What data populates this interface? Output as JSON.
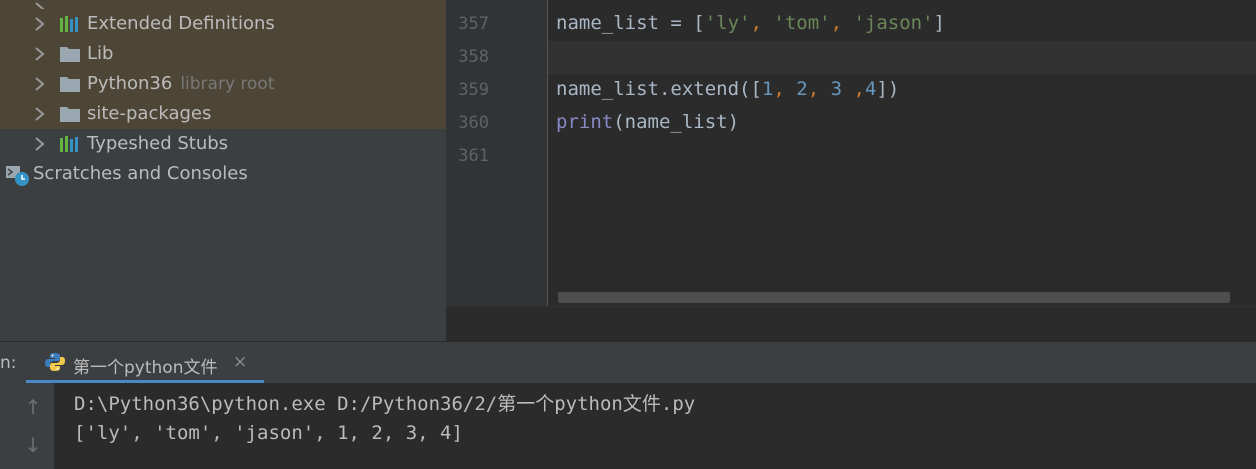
{
  "project_tree": {
    "items": [
      {
        "label": "Extended Definitions",
        "icon": "library-icon"
      },
      {
        "label": "Lib",
        "icon": "folder-icon"
      },
      {
        "label": "Python36",
        "hint": "library root",
        "icon": "folder-icon"
      },
      {
        "label": "site-packages",
        "icon": "folder-icon"
      },
      {
        "label": "Typeshed Stubs",
        "icon": "library-icon"
      }
    ],
    "scratches_label": "Scratches and Consoles"
  },
  "editor": {
    "lines": [
      {
        "number": "357"
      },
      {
        "number": "358"
      },
      {
        "number": "359"
      },
      {
        "number": "360"
      },
      {
        "number": "361"
      }
    ],
    "code": {
      "l357": {
        "a": "name_list = [",
        "s1": "'ly'",
        "c1": ", ",
        "s2": "'tom'",
        "c2": ", ",
        "s3": "'jason'",
        "b": "]"
      },
      "l359": {
        "a": "name_list.extend([",
        "n1": "1",
        "c1": ", ",
        "n2": "2",
        "c2": ", ",
        "n3": "3",
        "c3": " ,",
        "n4": "4",
        "b": "])"
      },
      "l360": {
        "fn": "print",
        "rest": "(name_list)"
      }
    }
  },
  "run_panel": {
    "label": "n:",
    "tab_label": "第一个python文件",
    "close_glyph": "×",
    "up_glyph": "↑",
    "down_glyph": "↓",
    "output": [
      "D:\\Python36\\python.exe D:/Python36/2/第一个python文件.py",
      "['ly', 'tom', 'jason', 1, 2, 3, 4]"
    ]
  },
  "colors": {
    "accent": "#4a88c7",
    "string": "#6a8759",
    "number": "#6897bb",
    "keyword": "#cc7832",
    "builtin": "#8888c6"
  }
}
